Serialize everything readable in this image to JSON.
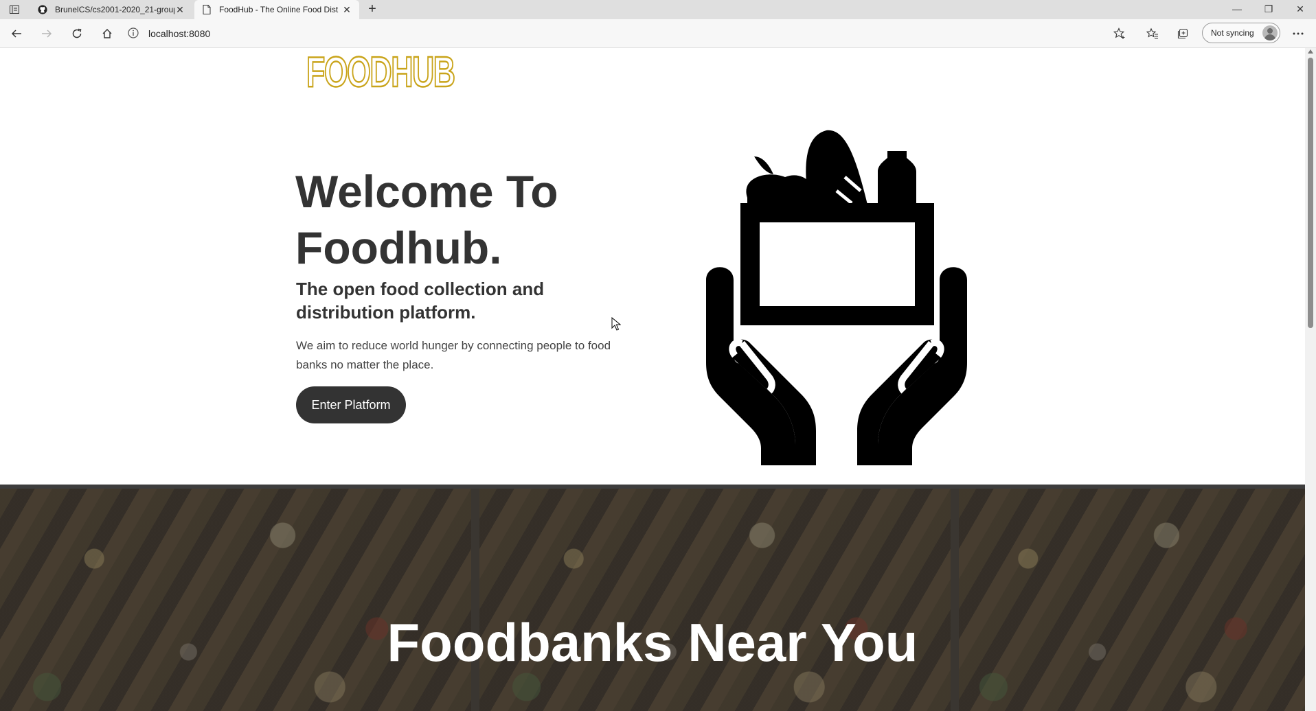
{
  "browser": {
    "tabs": [
      {
        "title": "BrunelCS/cs2001-2020_21-group",
        "icon": "github-icon",
        "active": false
      },
      {
        "title": "FoodHub - The Online Food Dist",
        "icon": "page-icon",
        "active": true
      }
    ],
    "new_tab_label": "+",
    "window_controls": {
      "minimize": "—",
      "maximize": "❐",
      "close": "✕"
    },
    "address_url": "localhost:8080",
    "sync_label": "Not syncing"
  },
  "page": {
    "logo": "FOODHUB",
    "hero": {
      "title_line1": "Welcome To",
      "title_line2": "Foodhub.",
      "subtitle": "The open food collection and distribution platform.",
      "description": "We aim to reduce world hunger by connecting people to food banks no matter the place.",
      "cta_label": "Enter Platform",
      "illustration": "hands-holding-grocery-box-icon"
    },
    "banner": {
      "title": "Foodbanks Near You"
    }
  },
  "colors": {
    "logo": "#c9a41a",
    "text": "#333333",
    "cta_bg": "#333333",
    "cta_text": "#ffffff",
    "banner_title": "#ffffff"
  }
}
